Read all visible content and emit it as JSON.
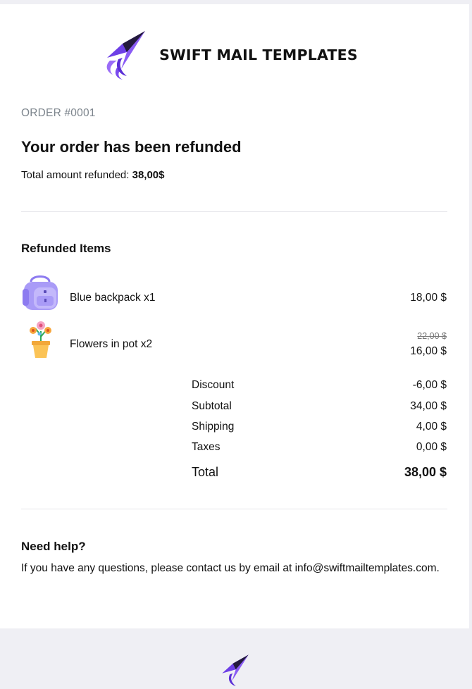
{
  "brand": {
    "name": "SWIFT MAIL TEMPLATES",
    "logo_icon": "paper-plane-icon",
    "accent": "#7b4bf0"
  },
  "order": {
    "number": "ORDER #0001",
    "heading": "Your order has been refunded",
    "refund_label": "Total amount refunded: ",
    "refund_amount": "38,00$"
  },
  "refunded": {
    "title": "Refunded Items",
    "items": [
      {
        "name": "Blue backpack x1",
        "price": "18,00 $",
        "icon": "backpack-icon"
      },
      {
        "name": "Flowers in pot x2",
        "old_price": "22,00 $",
        "price": "16,00 $",
        "icon": "potted-flower-icon"
      }
    ]
  },
  "totals": {
    "discount_label": "Discount",
    "discount": "-6,00 $",
    "subtotal_label": "Subtotal",
    "subtotal": "34,00 $",
    "shipping_label": "Shipping",
    "shipping": "4,00 $",
    "taxes_label": "Taxes",
    "taxes": "0,00 $",
    "total_label": "Total",
    "total": "38,00 $"
  },
  "help": {
    "title": "Need help?",
    "text": "If you have any questions, please contact us by email at info@swiftmailtemplates.com."
  }
}
